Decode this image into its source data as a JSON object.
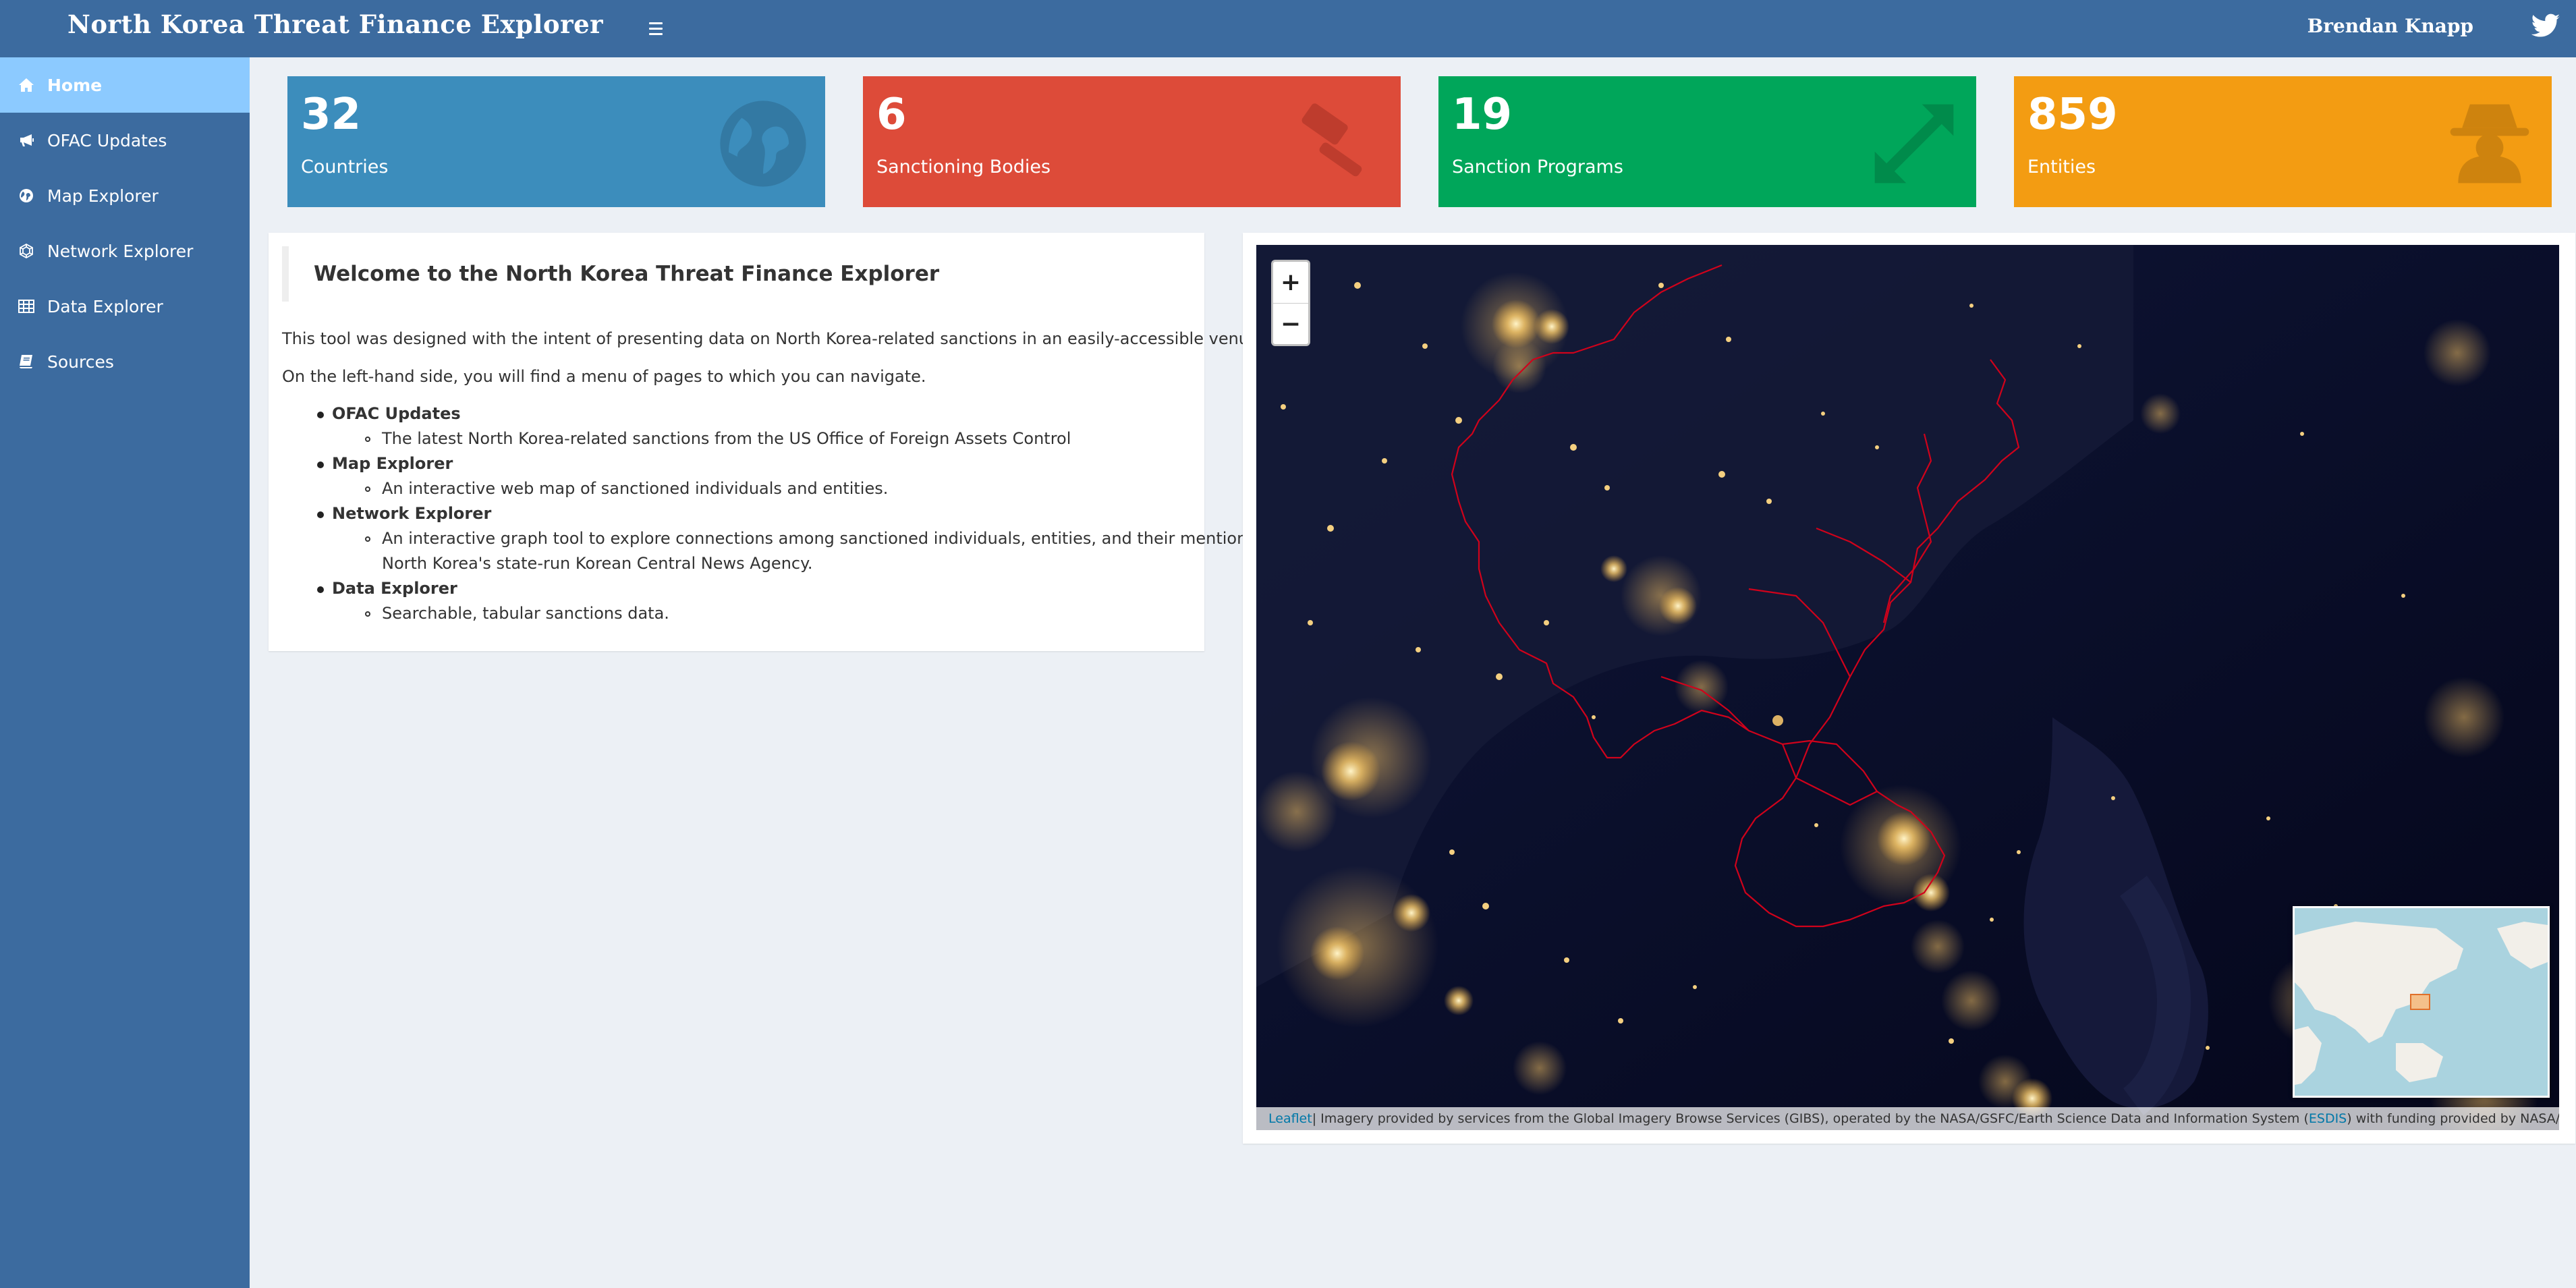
{
  "header": {
    "title": "North Korea Threat Finance Explorer",
    "user_name": "Brendan Knapp",
    "menu_icon": "hamburger-icon",
    "social_icon": "twitter-icon"
  },
  "sidebar": {
    "items": [
      {
        "label": "Home",
        "icon": "home-icon",
        "active": true
      },
      {
        "label": "OFAC Updates",
        "icon": "bullhorn-icon",
        "active": false
      },
      {
        "label": "Map Explorer",
        "icon": "globe-icon",
        "active": false
      },
      {
        "label": "Network Explorer",
        "icon": "network-icon",
        "active": false
      },
      {
        "label": "Data Explorer",
        "icon": "table-icon",
        "active": false
      },
      {
        "label": "Sources",
        "icon": "book-icon",
        "active": false
      }
    ]
  },
  "value_boxes": [
    {
      "value": "32",
      "label": "Countries",
      "icon": "globe-icon",
      "color": "#3c8dbc"
    },
    {
      "value": "6",
      "label": "Sanctioning Bodies",
      "icon": "gavel-icon",
      "color": "#dd4b39"
    },
    {
      "value": "19",
      "label": "Sanction Programs",
      "icon": "arrows-expand-icon",
      "color": "#00a65a"
    },
    {
      "value": "859",
      "label": "Entities",
      "icon": "user-secret-icon",
      "color": "#f39c12"
    }
  ],
  "welcome": {
    "title": "Welcome to the North Korea Threat Finance Explorer",
    "intro": "This tool was designed with the intent of presenting data on North Korea-related sanctions in an easily-accessible venue.",
    "nav_hint": "On the left-hand side, you will find a menu of pages to which you can navigate.",
    "items": [
      {
        "title": "OFAC Updates",
        "lines": [
          "The latest North Korea-related sanctions from the US Office of Foreign Assets Control"
        ]
      },
      {
        "title": "Map Explorer",
        "lines": [
          "An interactive web map of sanctioned individuals and entities."
        ]
      },
      {
        "title": "Network Explorer",
        "lines": [
          "An interactive graph tool to explore connections among sanctioned individuals, entities, and their mentions in",
          "North Korea's state-run Korean Central News Agency."
        ]
      },
      {
        "title": "Data Explorer",
        "lines": [
          "Searchable, tabular sanctions data."
        ]
      }
    ]
  },
  "map": {
    "zoom_in": "+",
    "zoom_out": "−",
    "attribution_link": "Leaflet",
    "attribution_text": " | Imagery provided by services from the Global Imagery Browse Services (GIBS), operated by the NASA/GSFC/Earth Science Data and Information System (",
    "attribution_link2": "ESDIS",
    "attribution_text2": ") with funding provided by NASA/HQ.",
    "border_color": "#d0021b"
  }
}
